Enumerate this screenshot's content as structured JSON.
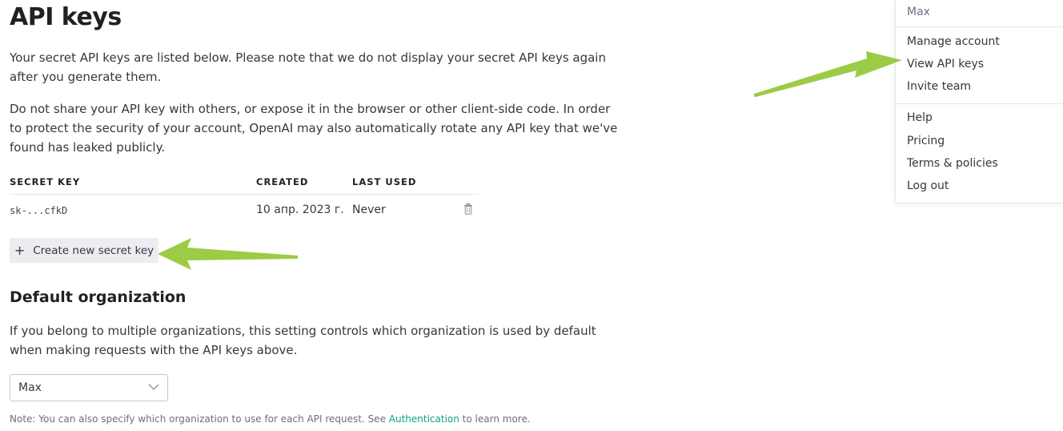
{
  "page": {
    "title": "API keys",
    "intro_1": "Your secret API keys are listed below. Please note that we do not display your secret API keys again after you generate them.",
    "intro_2": "Do not share your API key with others, or expose it in the browser or other client-side code. In order to protect the security of your account, OpenAI may also automatically rotate any API key that we've found has leaked publicly."
  },
  "keys_table": {
    "headers": [
      "SECRET KEY",
      "CREATED",
      "LAST USED"
    ],
    "rows": [
      {
        "key": "sk-...cfkD",
        "created": "10 апр. 2023 г.",
        "last_used": "Never"
      }
    ]
  },
  "create_button": {
    "icon": "plus-icon",
    "label": "Create new secret key"
  },
  "default_org": {
    "heading": "Default organization",
    "description": "If you belong to multiple organizations, this setting controls which organization is used by default when making requests with the API keys above.",
    "selected": "Max",
    "note_prefix": "Note: You can also specify which organization to use for each API request. See ",
    "note_link": "Authentication",
    "note_suffix": " to learn more."
  },
  "account_menu": {
    "user": "Max",
    "items_group1": [
      "Manage account",
      "View API keys",
      "Invite team"
    ],
    "items_group2": [
      "Help",
      "Pricing",
      "Terms & policies",
      "Log out"
    ]
  },
  "colors": {
    "accent_link": "#10a37f",
    "annotation_arrow": "#9ccb45",
    "button_bg": "#ececf1"
  }
}
